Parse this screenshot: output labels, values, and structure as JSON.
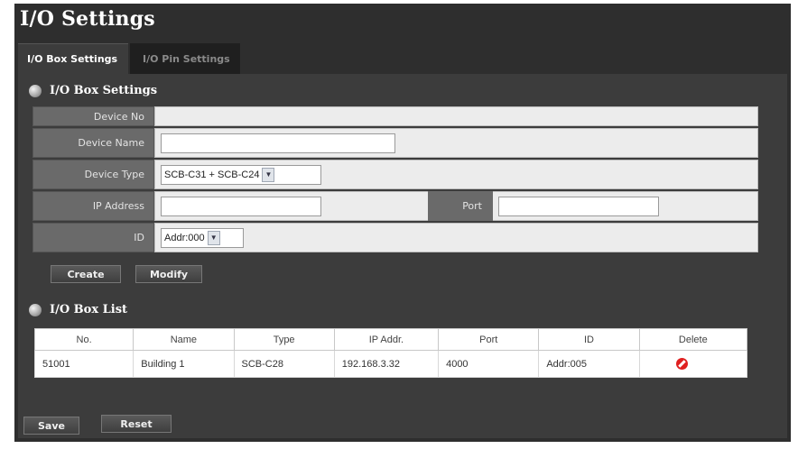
{
  "page": {
    "title": "I/O Settings"
  },
  "tabs": [
    {
      "label": "I/O Box Settings",
      "active": true
    },
    {
      "label": "I/O Pin Settings",
      "active": false
    }
  ],
  "box_settings": {
    "header": "I/O Box Settings",
    "device_no": {
      "label": "Device No",
      "value": ""
    },
    "device_name": {
      "label": "Device Name",
      "value": "",
      "placeholder": ""
    },
    "device_type": {
      "label": "Device Type",
      "selected": "SCB-C31 + SCB-C24"
    },
    "ip_address": {
      "label": "IP Address",
      "value": ""
    },
    "port": {
      "label": "Port",
      "value": ""
    },
    "id": {
      "label": "ID",
      "selected": "Addr:000"
    },
    "buttons": {
      "create": "Create",
      "modify": "Modify"
    }
  },
  "box_list": {
    "header": "I/O Box List",
    "columns": [
      "No.",
      "Name",
      "Type",
      "IP Addr.",
      "Port",
      "ID",
      "Delete"
    ],
    "rows": [
      {
        "no": "51001",
        "name": "Building 1",
        "type": "SCB-C28",
        "ip": "192.168.3.32",
        "port": "4000",
        "id": "Addr:005"
      }
    ]
  },
  "footer": {
    "save": "Save",
    "reset": "Reset"
  },
  "icons": {
    "bullet": "section-bullet-icon",
    "delete": "delete-icon",
    "dropdown": "chevron-down-icon"
  },
  "colors": {
    "panel_bg": "#2e2e2e",
    "content_bg": "#3c3c3c",
    "label_bg": "#6a6a6a",
    "delete_red": "#e02020"
  }
}
